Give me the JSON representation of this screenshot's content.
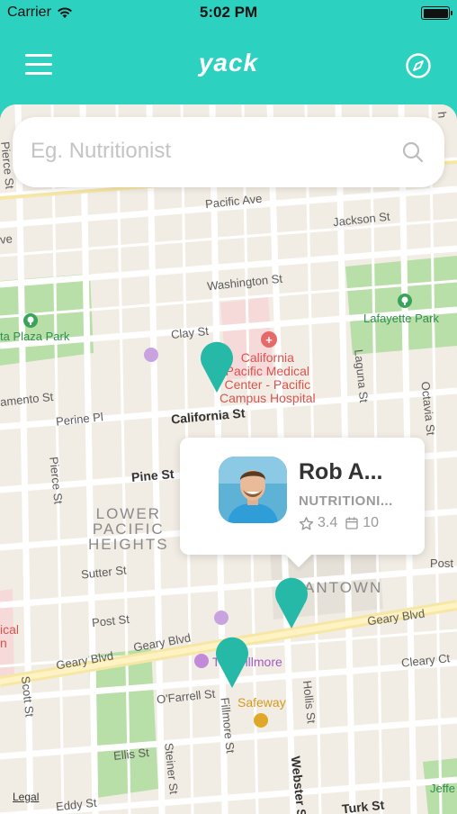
{
  "status_bar": {
    "carrier": "Carrier",
    "time": "5:02 PM"
  },
  "nav": {
    "logo": "yack",
    "menu_icon": "hamburger-icon",
    "compass_icon": "compass-icon"
  },
  "search": {
    "placeholder": "Eg. Nutritionist",
    "value": ""
  },
  "map": {
    "streets": {
      "pacific_ave": "Pacific Ave",
      "jackson_st": "Jackson St",
      "washington_st": "Washington St",
      "clay_st": "Clay St",
      "california_st": "California St",
      "perine_pl": "Perine Pl",
      "pine_st": "Pine St",
      "sutter_st": "Sutter St",
      "post_st_left": "Post St",
      "post_st_right": "Post St",
      "geary_blvd_left": "Geary Blvd",
      "geary_blvd_mid": "Geary Blvd",
      "geary_blvd_right": "Geary Blvd",
      "ofarrell_st": "O'Farrell St",
      "ellis_st": "Ellis St",
      "eddy_st": "Eddy St",
      "turk_st": "Turk St",
      "cleary_ct": "Cleary Ct",
      "pierce_st_top": "Pierce St",
      "pierce_st_mid": "Pierce St",
      "scott_st": "Scott St",
      "steiner_st": "Steiner St",
      "fillmore_st": "Fillmore St",
      "webster_st": "Webster St",
      "hollis_st": "Hollis St",
      "laguna_st": "Laguna St",
      "octavia_st": "Octavia St",
      "mento_st": "amento St",
      "ave_fragment": "ve",
      "fragment_h": "h"
    },
    "parks": {
      "alta_plaza": "ta Plaza Park",
      "lafayette": "Lafayette Park",
      "jeff": "Jeffe"
    },
    "districts": {
      "lower_pacific_heights": "LOWER\nPACIFIC\nHEIGHTS",
      "japantown": "ANTOWN"
    },
    "pois": {
      "hospital": "California\nPacific Medical\nCenter - Pacific\nCampus Hospital",
      "fillmore": "The Fillmore",
      "safeway": "Safeway",
      "left_red": "ical\nn"
    },
    "legal": "Legal"
  },
  "callout": {
    "name": "Rob A...",
    "role": "NUTRITIONI...",
    "rating": "3.4",
    "sessions": "10",
    "star_icon": "star-icon",
    "calendar_icon": "calendar-icon"
  },
  "colors": {
    "primary": "#2dd1bf",
    "pin": "#26b9a8"
  }
}
